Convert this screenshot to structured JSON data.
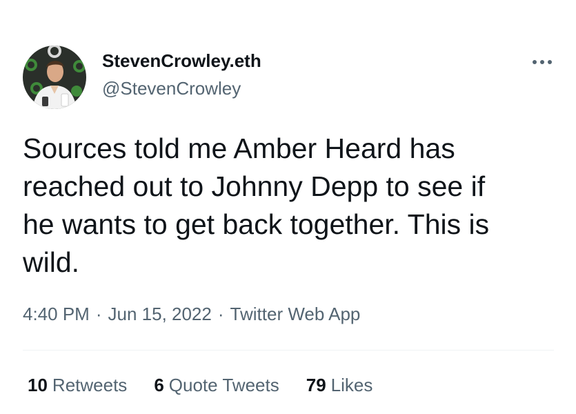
{
  "user": {
    "display_name": "StevenCrowley.eth",
    "handle": "@StevenCrowley",
    "avatar_icon": "profile-photo"
  },
  "more_icon": "more-dots-icon",
  "tweet": {
    "text": "Sources told me Amber Heard has\nreached out to Johnny Depp to see if\nhe wants to get back together. This is\nwild."
  },
  "meta": {
    "time": "4:40 PM",
    "separator": "·",
    "date": "Jun 15, 2022",
    "source": "Twitter Web App"
  },
  "stats": {
    "retweets": {
      "count": "10",
      "label": "Retweets"
    },
    "quote_tweets": {
      "count": "6",
      "label": "Quote Tweets"
    },
    "likes": {
      "count": "79",
      "label": "Likes"
    }
  },
  "colors": {
    "primary_text": "#0f1419",
    "secondary_text": "#536471",
    "divider": "#eff3f4",
    "background": "#ffffff"
  }
}
